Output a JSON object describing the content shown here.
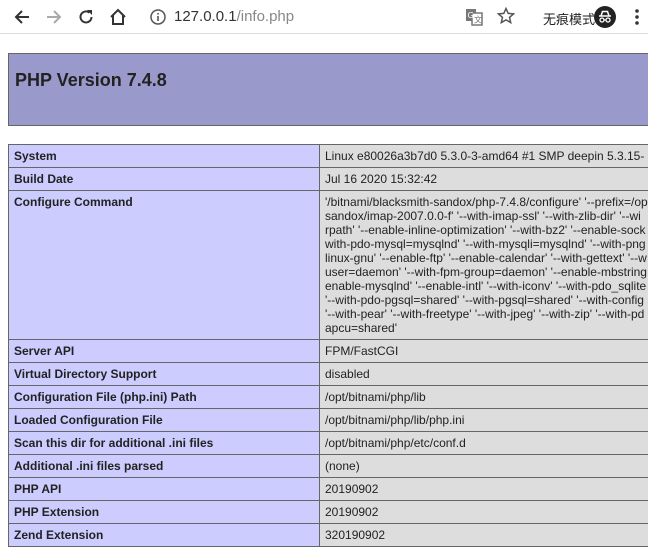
{
  "browser": {
    "url_host": "127.0.0.1",
    "url_path": "/info.php",
    "incognito_label": "无痕模式"
  },
  "page": {
    "title": "PHP Version 7.4.8"
  },
  "rows": [
    {
      "key": "System",
      "value": "Linux e80026a3b7d0 5.3.0-3-amd64 #1 SMP deepin 5.3.15-"
    },
    {
      "key": "Build Date",
      "value": "Jul 16 2020 15:32:42"
    },
    {
      "key": "Configure Command",
      "value": "'/bitnami/blacksmith-sandox/php-7.4.8/configure' '--prefix=/op sandox/imap-2007.0.0-f' '--with-imap-ssl' '--with-zlib-dir' '--wi rpath' '--enable-inline-optimization' '--with-bz2' '--enable-sock with-pdo-mysql=mysqlnd' '--with-mysqli=mysqlnd' '--with-png linux-gnu' '--enable-ftp' '--enable-calendar' '--with-gettext' '--w user=daemon' '--with-fpm-group=daemon' '--enable-mbstring enable-mysqlnd' '--enable-intl' '--with-iconv' '--with-pdo_sqlite '--with-pdo-pgsql=shared' '--with-pgsql=shared' '--with-config '--with-pear' '--with-freetype' '--with-jpeg' '--with-zip' '--with-pd apcu=shared'"
    },
    {
      "key": "Server API",
      "value": "FPM/FastCGI"
    },
    {
      "key": "Virtual Directory Support",
      "value": "disabled"
    },
    {
      "key": "Configuration File (php.ini) Path",
      "value": "/opt/bitnami/php/lib"
    },
    {
      "key": "Loaded Configuration File",
      "value": "/opt/bitnami/php/lib/php.ini"
    },
    {
      "key": "Scan this dir for additional .ini files",
      "value": "/opt/bitnami/php/etc/conf.d"
    },
    {
      "key": "Additional .ini files parsed",
      "value": "(none)"
    },
    {
      "key": "PHP API",
      "value": "20190902"
    },
    {
      "key": "PHP Extension",
      "value": "20190902"
    },
    {
      "key": "Zend Extension",
      "value": "320190902"
    }
  ],
  "configure_lines": [
    "'/bitnami/blacksmith-sandox/php-7.4.8/configure' '--prefix=/op",
    "sandox/imap-2007.0.0-f' '--with-imap-ssl' '--with-zlib-dir' '--wi",
    "rpath' '--enable-inline-optimization' '--with-bz2' '--enable-sock",
    "with-pdo-mysql=mysqlnd' '--with-mysqli=mysqlnd' '--with-png",
    "linux-gnu' '--enable-ftp' '--enable-calendar' '--with-gettext' '--w",
    "user=daemon' '--with-fpm-group=daemon' '--enable-mbstring",
    "enable-mysqlnd' '--enable-intl' '--with-iconv' '--with-pdo_sqlite",
    "'--with-pdo-pgsql=shared' '--with-pgsql=shared' '--with-config",
    "'--with-pear' '--with-freetype' '--with-jpeg' '--with-zip' '--with-pd",
    "apcu=shared'"
  ]
}
